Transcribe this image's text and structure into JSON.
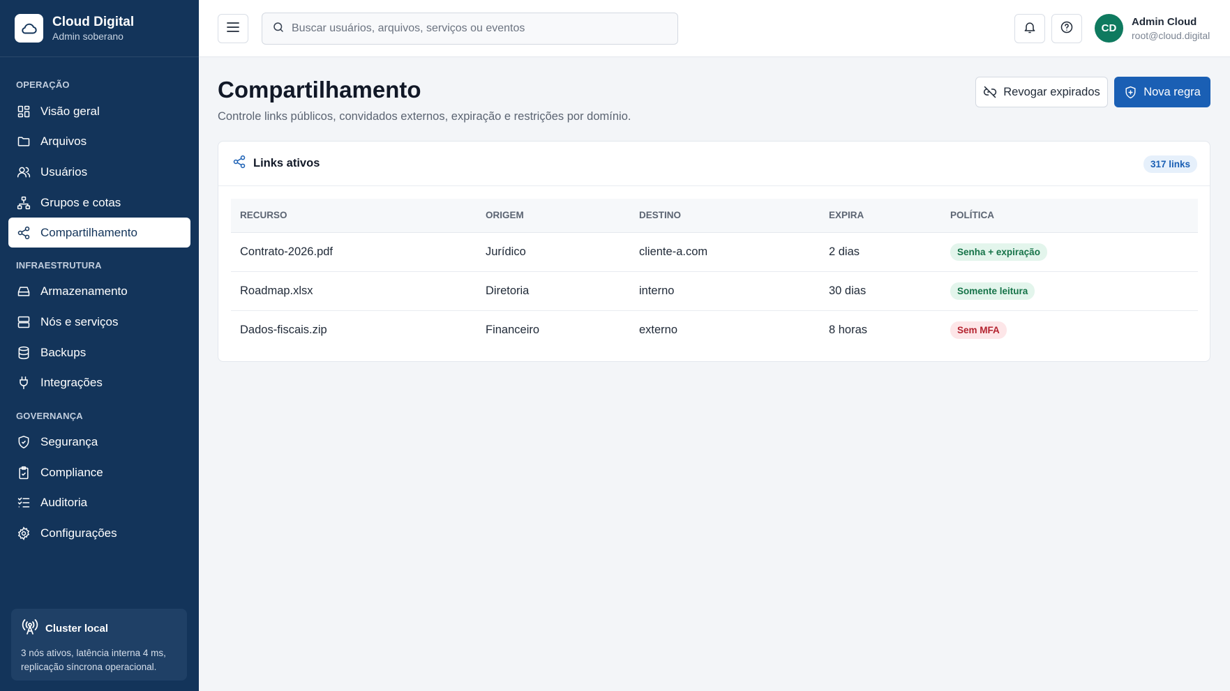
{
  "brand": {
    "title": "Cloud Digital",
    "subtitle": "Admin soberano"
  },
  "sidebar": {
    "sections": [
      {
        "label": "OPERAÇÃO"
      },
      {
        "label": "INFRAESTRUTURA"
      },
      {
        "label": "GOVERNANÇA"
      }
    ],
    "items": [
      {
        "label": "Visão geral",
        "icon": "grid-icon"
      },
      {
        "label": "Arquivos",
        "icon": "folder-icon"
      },
      {
        "label": "Usuários",
        "icon": "users-icon"
      },
      {
        "label": "Grupos e cotas",
        "icon": "hierarchy-icon"
      },
      {
        "label": "Compartilhamento",
        "icon": "share-icon",
        "active": true
      },
      {
        "label": "Armazenamento",
        "icon": "drive-icon"
      },
      {
        "label": "Nós e serviços",
        "icon": "server-icon"
      },
      {
        "label": "Backups",
        "icon": "database-icon"
      },
      {
        "label": "Integrações",
        "icon": "plug-icon"
      },
      {
        "label": "Segurança",
        "icon": "shield-icon"
      },
      {
        "label": "Compliance",
        "icon": "clipboard-check-icon"
      },
      {
        "label": "Auditoria",
        "icon": "list-check-icon"
      },
      {
        "label": "Configurações",
        "icon": "gear-icon"
      }
    ],
    "cluster": {
      "title": "Cluster local",
      "text": "3 nós ativos, latência interna 4 ms, replicação síncrona operacional."
    }
  },
  "topbar": {
    "search_placeholder": "Buscar usuários, arquivos, serviços ou eventos",
    "user": {
      "initials": "CD",
      "name": "Admin Cloud",
      "email": "root@cloud.digital"
    }
  },
  "page": {
    "title": "Compartilhamento",
    "subtitle": "Controle links públicos, convidados externos, expiração e restrições por domínio.",
    "revoke_label": "Revogar expirados",
    "new_rule_label": "Nova regra"
  },
  "card": {
    "title": "Links ativos",
    "count": "317 links",
    "columns": [
      "RECURSO",
      "ORIGEM",
      "DESTINO",
      "EXPIRA",
      "POLÍTICA"
    ],
    "rows": [
      {
        "resource": "Contrato-2026.pdf",
        "origin": "Jurídico",
        "destination": "cliente-a.com",
        "expires": "2 dias",
        "policy": "Senha + expiração",
        "policy_tone": "green"
      },
      {
        "resource": "Roadmap.xlsx",
        "origin": "Diretoria",
        "destination": "interno",
        "expires": "30 dias",
        "policy": "Somente leitura",
        "policy_tone": "green"
      },
      {
        "resource": "Dados-fiscais.zip",
        "origin": "Financeiro",
        "destination": "externo",
        "expires": "8 horas",
        "policy": "Sem MFA",
        "policy_tone": "red"
      }
    ]
  },
  "colors": {
    "sidebar": "#13345a",
    "primary": "#1a5fb4",
    "success": "#157348",
    "danger": "#b4232f",
    "avatar": "#0f7a5f"
  }
}
